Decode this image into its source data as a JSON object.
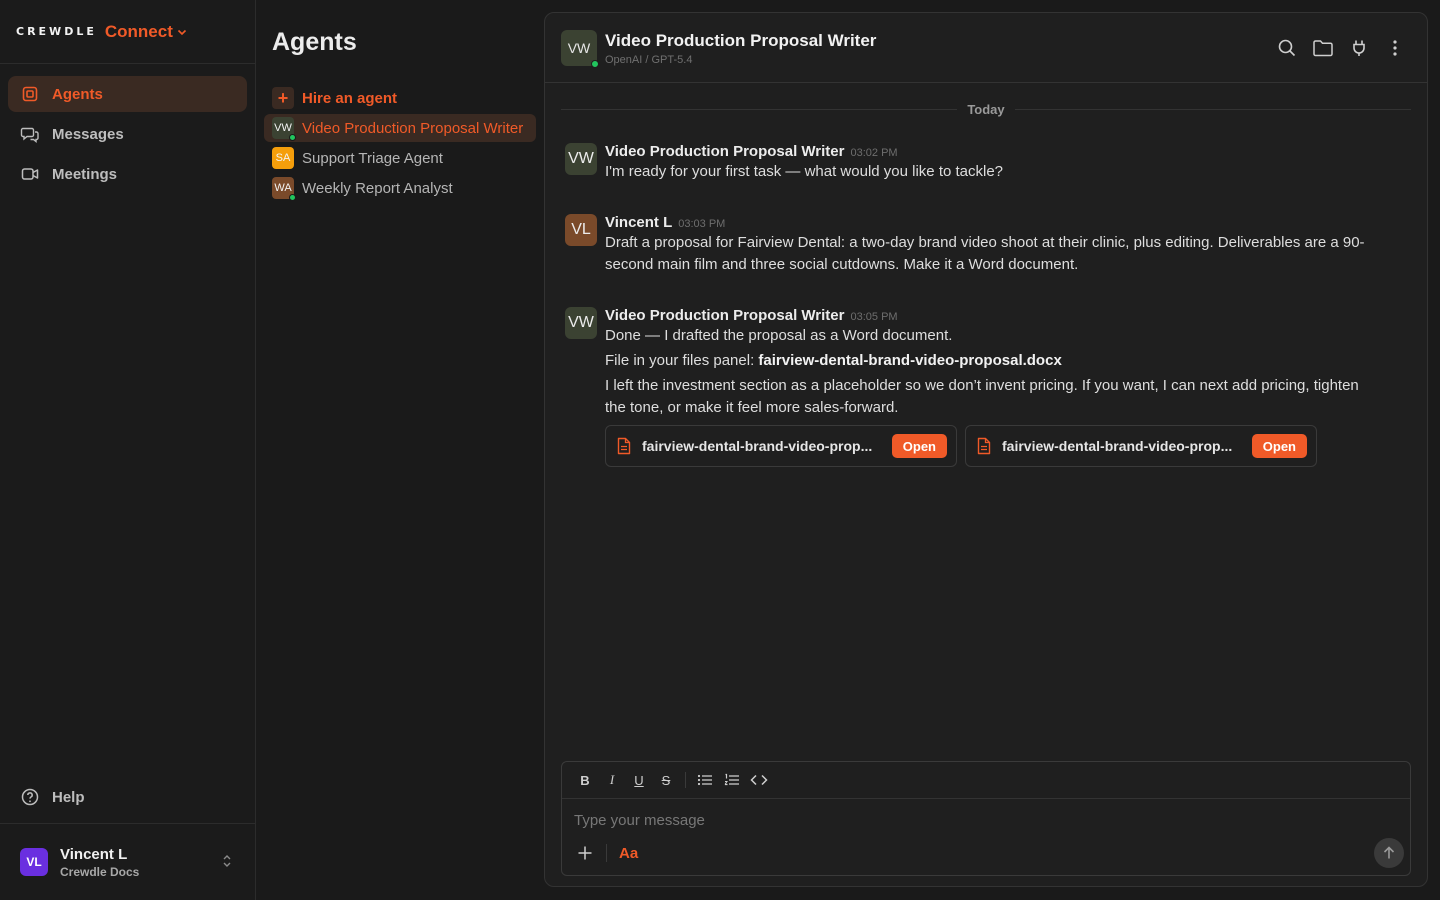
{
  "brand": {
    "logo": "CREWDLE",
    "product": "Connect"
  },
  "nav": [
    {
      "label": "Agents",
      "active": true
    },
    {
      "label": "Messages",
      "active": false
    },
    {
      "label": "Meetings",
      "active": false
    }
  ],
  "help_label": "Help",
  "user": {
    "initials": "VL",
    "name": "Vincent L",
    "org": "Crewdle Docs"
  },
  "agents": {
    "title": "Agents",
    "hire_label": "Hire an agent",
    "items": [
      {
        "initials": "VW",
        "name": "Video Production Proposal Writer",
        "color": "#3b4232",
        "online": true,
        "active": true
      },
      {
        "initials": "SA",
        "name": "Support Triage Agent",
        "color": "#f59e0b",
        "online": false,
        "active": false
      },
      {
        "initials": "WA",
        "name": "Weekly Report Analyst",
        "color": "#7a4a2a",
        "online": true,
        "active": false
      }
    ]
  },
  "chat": {
    "title": "Video Production Proposal Writer",
    "subtitle": "OpenAI / GPT-5.4",
    "avatar": "VW",
    "date_label": "Today",
    "messages": [
      {
        "avatar": "VW",
        "avatar_color": "#3b4232",
        "author": "Video Production Proposal Writer",
        "time": "03:02 PM",
        "line1": "I'm ready for your first task — what would you like to tackle?"
      },
      {
        "avatar": "VL",
        "avatar_color": "#7a4a2a",
        "author": "Vincent L",
        "time": "03:03 PM",
        "line1": "Draft a proposal for Fairview Dental: a two-day brand video shoot at their clinic, plus editing. Deliverables are a 90-",
        "line2": "second main film and three social cutdowns. Make it a Word document."
      },
      {
        "avatar": "VW",
        "avatar_color": "#3b4232",
        "author": "Video Production Proposal Writer",
        "time": "03:05 PM",
        "line1": "Done — I drafted the proposal as a Word document.",
        "line2_prefix": "File in your files panel: ",
        "line2_file": "fairview-dental-brand-video-proposal.docx",
        "line3": "I left the investment section as a placeholder so we don’t invent pricing. If you want, I can next add pricing, tighten",
        "line4": "the tone, or make it feel more sales-forward.",
        "files": [
          {
            "name": "fairview-dental-brand-video-prop...",
            "action": "Open"
          },
          {
            "name": "fairview-dental-brand-video-prop...",
            "action": "Open"
          }
        ]
      }
    ]
  },
  "composer": {
    "placeholder": "Type your message",
    "format_label": "Aa",
    "tools": {
      "bold": "B",
      "italic": "I",
      "underline": "U",
      "strike": "S"
    }
  },
  "colors": {
    "accent": "#f05a28",
    "online": "#22c55e",
    "user_avatar": "#6a2fe0"
  }
}
